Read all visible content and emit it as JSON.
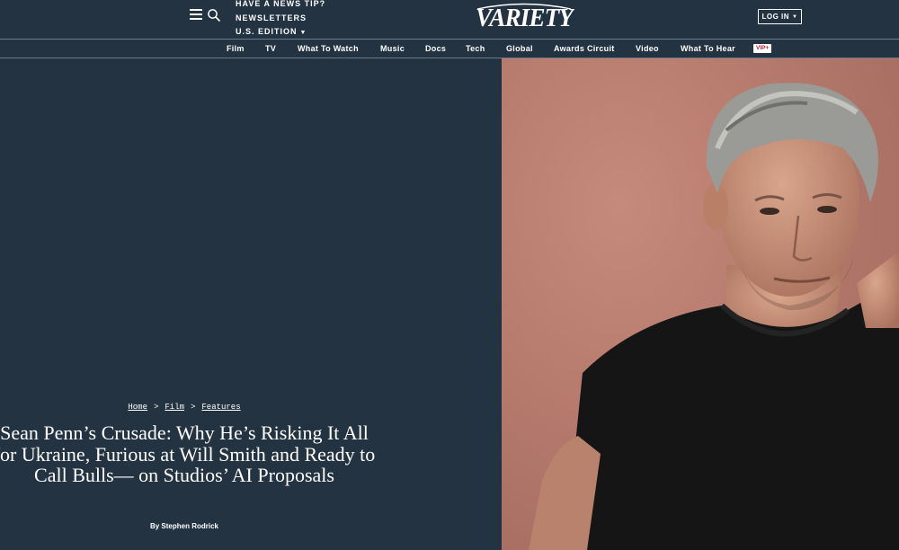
{
  "header": {
    "util_links": [
      "HAVE A NEWS TIP?",
      "NEWSLETTERS",
      "U.S. EDITION"
    ],
    "logo_text": "VARIETY",
    "login_label": "LOG IN"
  },
  "nav": {
    "items": [
      "Film",
      "TV",
      "What To Watch",
      "Music",
      "Docs",
      "Tech",
      "Global",
      "Awards Circuit",
      "Video",
      "What To Hear"
    ],
    "vip_label": "VIP+"
  },
  "article": {
    "breadcrumb": [
      "Home",
      "Film",
      "Features"
    ],
    "headline": "Sean Penn’s Crusade: Why He’s Risking It All for Ukraine, Furious at Will Smith and Ready to Call Bulls— on Studios’ AI Proposals",
    "byline": "By Stephen Rodrick"
  },
  "icons": {
    "menu": "hamburger-menu-icon",
    "search": "search-icon"
  },
  "colors": {
    "background": "#243342",
    "vip_red": "#c21e3a",
    "photo_wall": "#b77c6e"
  }
}
